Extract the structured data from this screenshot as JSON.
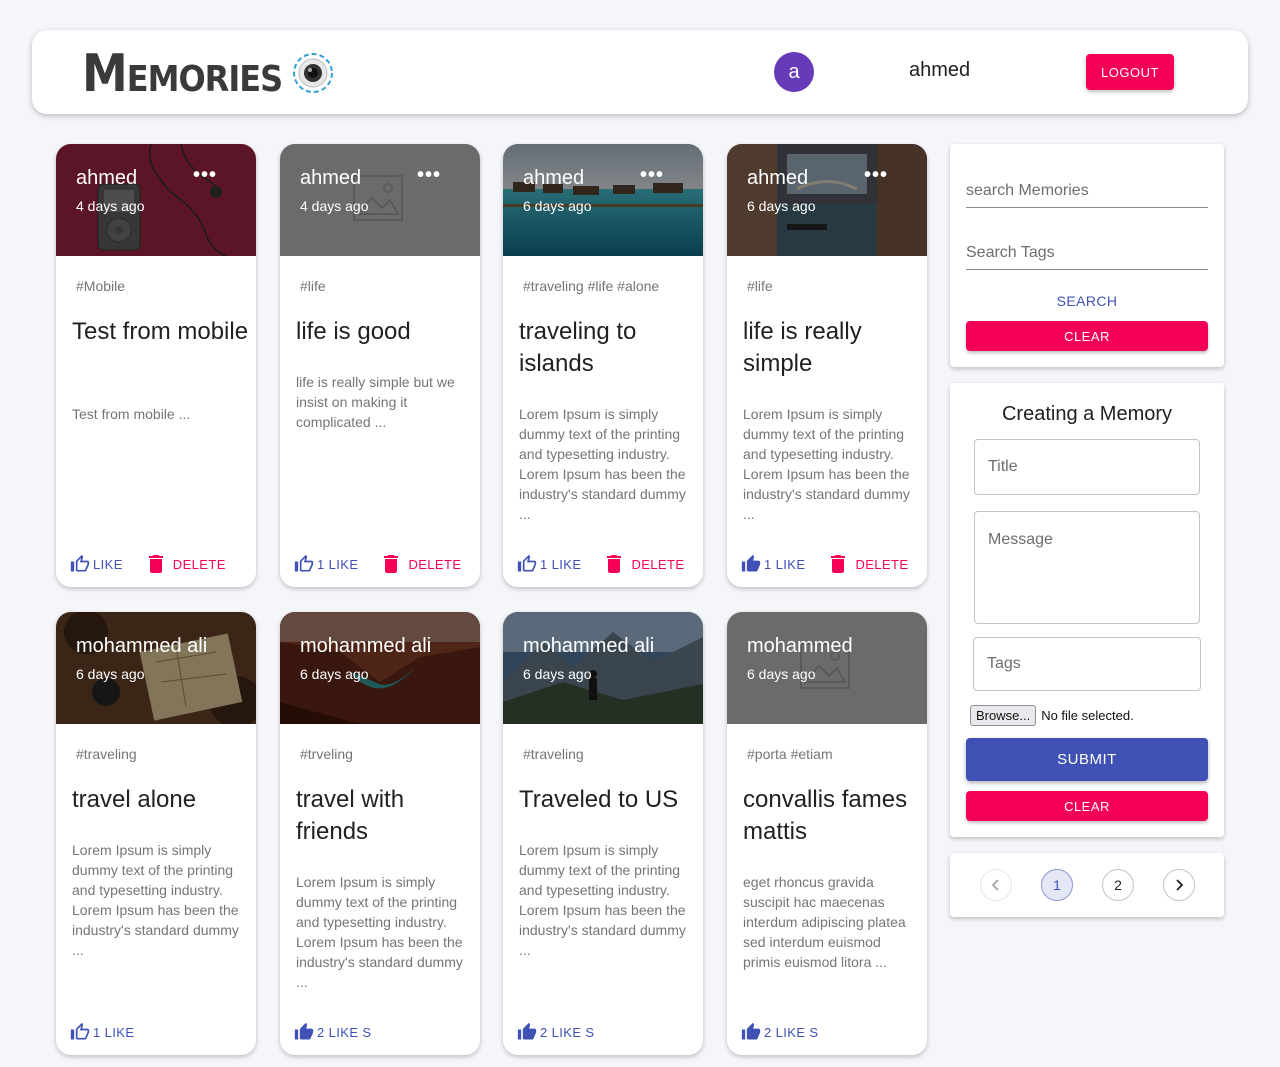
{
  "header": {
    "brand": "Memories",
    "avatar_initial": "a",
    "username": "ahmed",
    "logout_label": "LOGOUT"
  },
  "posts": [
    {
      "author": "ahmed",
      "time": "4 days ago",
      "tags": "#Mobile",
      "title": "Test from mobile",
      "message": "Test from mobile ...",
      "likes": "LIKE",
      "delete_label": "DELETE",
      "image": "ipod"
    },
    {
      "author": "ahmed",
      "time": "4 days ago",
      "tags": "#life",
      "title": "life is good",
      "message": "life is really simple but we insist on making it complicated ...",
      "likes": "1 LIKE",
      "delete_label": "DELETE",
      "image": "placeholder"
    },
    {
      "author": "ahmed",
      "time": "6 days ago",
      "tags": "#traveling #life #alone",
      "title": "traveling to islands",
      "message": "Lorem Ipsum is simply dummy text of the printing and typesetting industry. Lorem Ipsum has been the industry's standard dummy ...",
      "likes": "1 LIKE",
      "delete_label": "DELETE",
      "image": "islands"
    },
    {
      "author": "ahmed",
      "time": "6 days ago",
      "tags": "#life",
      "title": "life is really simple",
      "message": "Lorem Ipsum is simply dummy text of the printing and typesetting industry. Lorem Ipsum has been the industry's standard dummy ...",
      "likes": "1 LIKE",
      "delete_label": "DELETE",
      "image": "venice"
    },
    {
      "author": "mohammed ali",
      "time": "6 days ago",
      "tags": "#traveling",
      "title": "travel alone",
      "message": "Lorem Ipsum is simply dummy text of the printing and typesetting industry. Lorem Ipsum has been the industry's standard dummy ...",
      "likes": "1 LIKE",
      "image": "map"
    },
    {
      "author": "mohammed ali",
      "time": "6 days ago",
      "tags": "#trveling",
      "title": "travel with friends",
      "message": "Lorem Ipsum is simply dummy text of the printing and typesetting industry. Lorem Ipsum has been the industry's standard dummy ...",
      "likes": "2 LIKE S",
      "image": "canyon"
    },
    {
      "author": "mohammed ali",
      "time": "6 days ago",
      "tags": "#traveling",
      "title": "Traveled to US",
      "message": "Lorem Ipsum is simply dummy text of the printing and typesetting industry. Lorem Ipsum has been the industry's standard dummy ...",
      "likes": "2 LIKE S",
      "image": "mountains"
    },
    {
      "author": "mohammed",
      "time": "6 days ago",
      "tags": "#porta #etiam",
      "title": "convallis fames mattis",
      "message": "eget rhoncus gravida suscipit hac maecenas interdum adipiscing platea sed interdum euismod primis euismod litora ...",
      "likes": "2 LIKE S",
      "image": "placeholder"
    }
  ],
  "search": {
    "memories_placeholder": "search Memories",
    "tags_placeholder": "Search Tags",
    "search_label": "SEARCH",
    "clear_label": "CLEAR"
  },
  "form": {
    "heading": "Creating a Memory",
    "title_placeholder": "Title",
    "message_placeholder": "Message",
    "tags_placeholder": "Tags",
    "file_button": "Browse...",
    "file_status": "No file selected.",
    "submit_label": "SUBMIT",
    "clear_label": "CLEAR"
  },
  "pagination": {
    "pages": [
      "1",
      "2"
    ],
    "current": "1"
  },
  "colors": {
    "primary": "#3f51b5",
    "secondary": "#f50057",
    "avatar": "#673ab7",
    "background": "#f5f6fa"
  }
}
